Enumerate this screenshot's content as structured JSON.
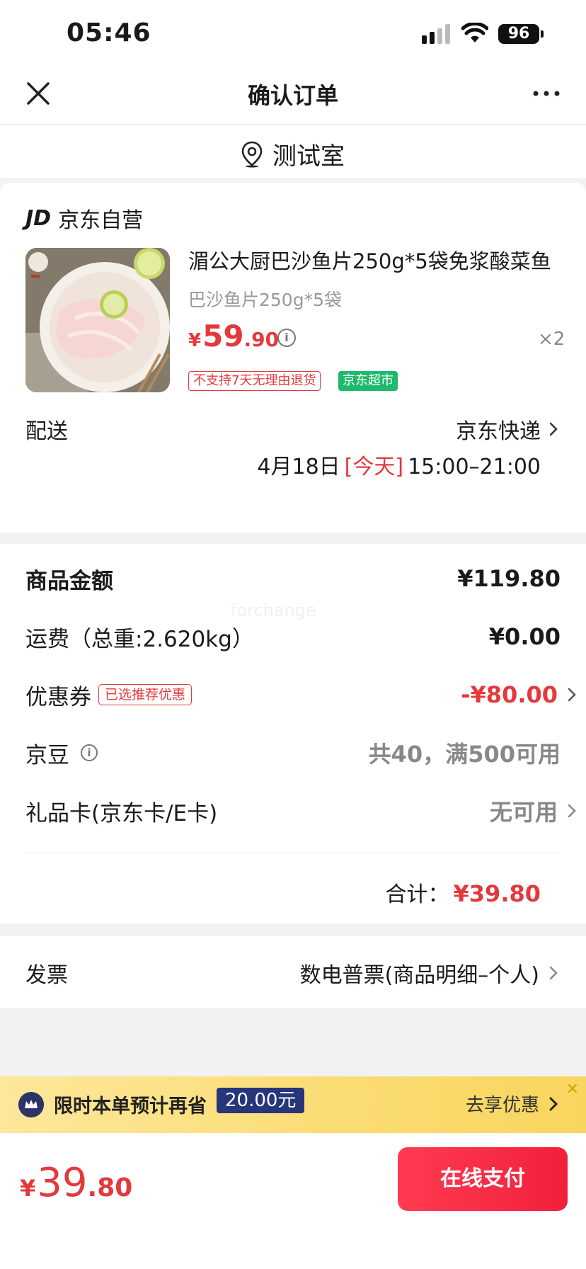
{
  "status_bar": {
    "time": "05:46",
    "battery": "96"
  },
  "nav": {
    "title": "确认订单"
  },
  "location": {
    "name": "测试室"
  },
  "shop": {
    "logo": "JD",
    "name": "京东自营"
  },
  "product": {
    "name": "湄公大厨巴沙鱼片250g*5袋免浆酸菜鱼",
    "spec": "巴沙鱼片250g*5袋",
    "price_symbol": "¥",
    "price_int": "59",
    "price_dec": ".90",
    "quantity": "×2",
    "tag_return": "不支持7天无理由退货",
    "tag_market": "京东超市"
  },
  "delivery": {
    "label": "配送",
    "carrier": "京东快递",
    "date": "4月18日",
    "today": "[今天]",
    "window": "15:00–21:00"
  },
  "summary": {
    "goods_label": "商品金额",
    "goods_value": "¥119.80",
    "shipping_label": "运费（总重:2.620kg）",
    "shipping_value": "¥0.00",
    "coupon_label": "优惠券",
    "coupon_tag": "已选推荐优惠",
    "coupon_value": "-¥80.00",
    "beans_label": "京豆",
    "beans_value": "共40，满500可用",
    "giftcard_label": "礼品卡(京东卡/E卡)",
    "giftcard_value": "无可用",
    "total_label": "合计：",
    "total_value": "¥39.80"
  },
  "invoice": {
    "label": "发票",
    "value": "数电普票(商品明细–个人)"
  },
  "promo": {
    "text": "限时本单预计再省",
    "amount": "20.00元",
    "action": "去享优惠"
  },
  "bottom": {
    "yen": "¥",
    "int": "39",
    "dec": ".80",
    "pay_label": "在线支付"
  },
  "watermark": "forchange",
  "colors": {
    "accent_red": "#e4393c",
    "green_tag": "#1fb96c",
    "promo_yellow": "#fbdc73",
    "promo_navy": "#27357a"
  }
}
